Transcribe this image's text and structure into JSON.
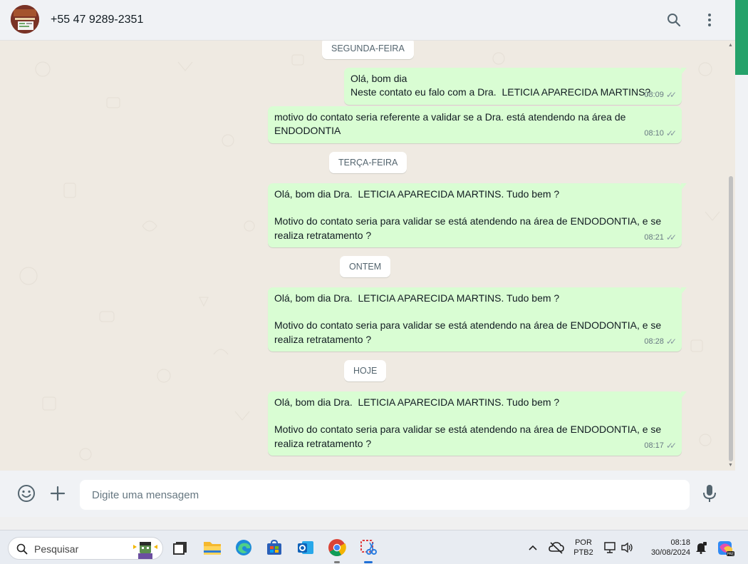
{
  "header": {
    "contact_name": "+55 47 9289-2351",
    "search_icon": "search-icon",
    "menu_icon": "kebab-menu-icon"
  },
  "chat": {
    "date_chips": [
      "SEGUNDA-FEIRA",
      "TERÇA-FEIRA",
      "ONTEM",
      "HOJE"
    ],
    "messages": [
      {
        "lines": [
          "Olá, bom dia",
          "Neste contato eu falo com a Dra.  LETICIA APARECIDA MARTINS?"
        ],
        "time": "08:09",
        "ticks": "✓✓"
      },
      {
        "lines": [
          "motivo do contato seria referente a validar se a Dra. está atendendo na área de",
          "ENDODONTIA"
        ],
        "time": "08:10",
        "ticks": "✓✓"
      },
      {
        "lines": [
          "Olá, bom dia Dra.  LETICIA APARECIDA MARTINS. Tudo bem ?",
          "",
          "Motivo do contato seria para validar se está atendendo na área de ENDODONTIA, e se",
          "realiza retratamento ?"
        ],
        "time": "08:21",
        "ticks": "✓✓"
      },
      {
        "lines": [
          "Olá, bom dia Dra.  LETICIA APARECIDA MARTINS. Tudo bem ?",
          "",
          "Motivo do contato seria para validar se está atendendo na área de ENDODONTIA, e se",
          "realiza retratamento ?"
        ],
        "time": "08:28",
        "ticks": "✓✓"
      },
      {
        "lines": [
          "Olá, bom dia Dra.  LETICIA APARECIDA MARTINS. Tudo bem ?",
          "",
          "Motivo do contato seria para validar se está atendendo na área de ENDODONTIA, e se",
          "realiza retratamento ?"
        ],
        "time": "08:17",
        "ticks": "✓✓"
      }
    ]
  },
  "composer": {
    "placeholder": "Digite uma mensagem",
    "emoji_icon": "emoji-icon",
    "attach_icon": "plus-icon",
    "mic_icon": "microphone-icon"
  },
  "taskbar": {
    "search_label": "Pesquisar",
    "language_top": "POR",
    "language_bottom": "PTB2",
    "time": "08:18",
    "date": "30/08/2024",
    "apps": [
      "task-view-icon",
      "file-explorer-icon",
      "edge-icon",
      "store-icon",
      "outlook-icon",
      "chrome-icon",
      "snipping-tool-icon"
    ]
  },
  "colors": {
    "outgoing_bubble": "#d9fdd3",
    "chat_background": "#efeae2",
    "panel": "#f0f2f5",
    "accent": "#25a26a"
  }
}
